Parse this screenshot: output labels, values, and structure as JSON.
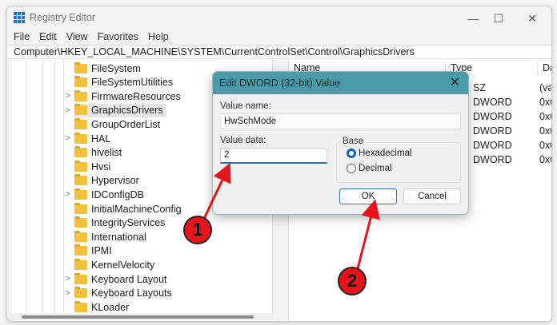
{
  "window": {
    "title": "Registry Editor",
    "minimize": "—",
    "maximize": "☐",
    "close": "✕"
  },
  "menu": [
    "File",
    "Edit",
    "View",
    "Favorites",
    "Help"
  ],
  "address": "Computer\\HKEY_LOCAL_MACHINE\\SYSTEM\\CurrentControlSet\\Control\\GraphicsDrivers",
  "tree": [
    {
      "label": "FileSystem",
      "expandable": false
    },
    {
      "label": "FileSystemUtilities",
      "expandable": false
    },
    {
      "label": "FirmwareResources",
      "expandable": true
    },
    {
      "label": "GraphicsDrivers",
      "expandable": true,
      "selected": true
    },
    {
      "label": "GroupOrderList",
      "expandable": false
    },
    {
      "label": "HAL",
      "expandable": true
    },
    {
      "label": "hivelist",
      "expandable": false
    },
    {
      "label": "Hvsi",
      "expandable": false
    },
    {
      "label": "Hypervisor",
      "expandable": false
    },
    {
      "label": "IDConfigDB",
      "expandable": true
    },
    {
      "label": "InitialMachineConfig",
      "expandable": false
    },
    {
      "label": "IntegrityServices",
      "expandable": false
    },
    {
      "label": "International",
      "expandable": false
    },
    {
      "label": "IPMI",
      "expandable": false
    },
    {
      "label": "KernelVelocity",
      "expandable": false
    },
    {
      "label": "Keyboard Layout",
      "expandable": true
    },
    {
      "label": "Keyboard Layouts",
      "expandable": true
    },
    {
      "label": "KLoader",
      "expandable": false
    }
  ],
  "values": {
    "headers": [
      "Name",
      "Type",
      "Da"
    ],
    "rows": [
      [
        "SZ",
        "(va"
      ],
      [
        "DWORD",
        "0x0"
      ],
      [
        "DWORD",
        "0x0"
      ],
      [
        "DWORD",
        "0x0"
      ],
      [
        "DWORD",
        "0x0"
      ],
      [
        "DWORD",
        "0x0"
      ]
    ]
  },
  "dialog": {
    "title": "Edit DWORD (32-bit) Value",
    "close": "✕",
    "value_name_label": "Value name:",
    "value_name": "HwSchMode",
    "value_data_label": "Value data:",
    "value_data": "2",
    "base_label": "Base",
    "hex": "Hexadecimal",
    "dec": "Decimal",
    "selected_base": "Hexadecimal",
    "ok": "OK",
    "cancel": "Cancel"
  },
  "annotations": {
    "step1": "1",
    "step2": "2",
    "color": "#e8141b"
  }
}
